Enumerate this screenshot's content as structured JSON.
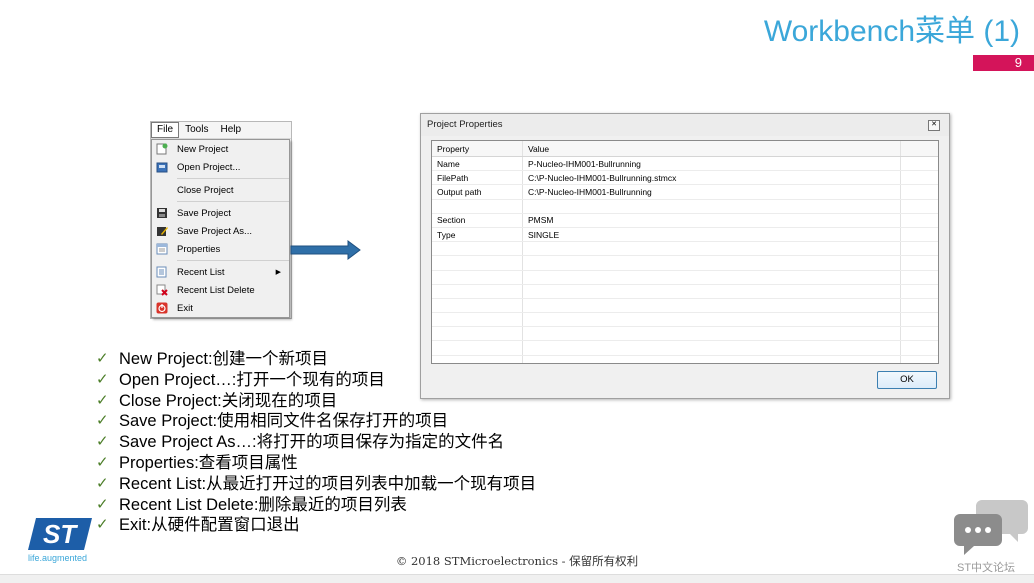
{
  "slide": {
    "title": "Workbench菜单 (1)",
    "page_number": "9",
    "footer": "© 2018 STMicroelectronics - 保留所有权利",
    "tagline": "life.augmented",
    "forum_label": "ST中文论坛"
  },
  "menu": {
    "bar": [
      "File",
      "Tools",
      "Help"
    ],
    "items": [
      {
        "label": "New Project",
        "icon": "new-project-icon"
      },
      {
        "label": "Open Project...",
        "icon": "open-project-icon"
      },
      {
        "label": "Close Project",
        "icon": ""
      },
      {
        "label": "Save Project",
        "icon": "save-icon"
      },
      {
        "label": "Save Project As...",
        "icon": "save-as-icon"
      },
      {
        "label": "Properties",
        "icon": "properties-icon"
      },
      {
        "label": "Recent List",
        "icon": "recent-list-icon"
      },
      {
        "label": "Recent List Delete",
        "icon": "recent-delete-icon"
      },
      {
        "label": "Exit",
        "icon": "exit-icon"
      }
    ]
  },
  "dialog": {
    "title": "Project Properties",
    "columns": [
      "Property",
      "Value"
    ],
    "rows": [
      [
        "Name",
        "P-Nucleo-IHM001-Bullrunning"
      ],
      [
        "FilePath",
        "C:\\P-Nucleo-IHM001-Bullrunning.stmcx"
      ],
      [
        "Output path",
        "C:\\P-Nucleo-IHM001-Bullrunning"
      ],
      [
        "",
        ""
      ],
      [
        "Section",
        "PMSM"
      ],
      [
        "Type",
        "SINGLE"
      ]
    ],
    "ok_label": "OK"
  },
  "bullets": [
    {
      "term": "New Project:",
      "desc": " 创建一个新项目"
    },
    {
      "term": "Open Project…:",
      "desc": " 打开一个现有的项目"
    },
    {
      "term": "Close Project:",
      "desc": " 关闭现在的项目"
    },
    {
      "term": "Save Project:",
      "desc": " 使用相同文件名保存打开的项目"
    },
    {
      "term": "Save Project As…:",
      "desc": " 将打开的项目保存为指定的文件名"
    },
    {
      "term": "Properties:",
      "desc": " 查看项目属性"
    },
    {
      "term": "Recent List:",
      "desc": " 从最近打开过的项目列表中加载一个现有项目"
    },
    {
      "term": "Recent List Delete:",
      "desc": " 删除最近的项目列表"
    },
    {
      "term": "Exit:",
      "desc": " 从硬件配置窗口退出"
    }
  ],
  "colors": {
    "title": "#3ba7d9",
    "badge": "#d4145a",
    "check": "#4d7f2a",
    "arrow": "#2f6fa8"
  }
}
